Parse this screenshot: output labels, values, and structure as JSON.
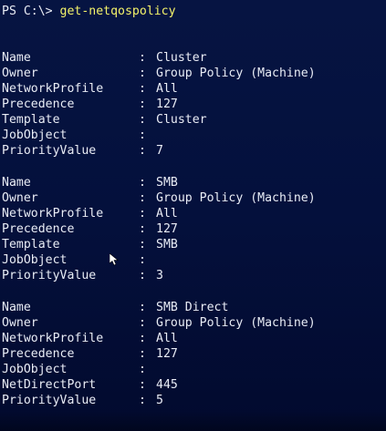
{
  "prompt": {
    "path": "PS C:\\>",
    "command": "get-netqospolicy"
  },
  "policies": [
    {
      "rows": [
        {
          "key": "Name",
          "value": "Cluster"
        },
        {
          "key": "Owner",
          "value": "Group Policy (Machine)"
        },
        {
          "key": "NetworkProfile",
          "value": "All"
        },
        {
          "key": "Precedence",
          "value": "127"
        },
        {
          "key": "Template",
          "value": "Cluster"
        },
        {
          "key": "JobObject",
          "value": ""
        },
        {
          "key": "PriorityValue",
          "value": "7"
        }
      ]
    },
    {
      "rows": [
        {
          "key": "Name",
          "value": "SMB"
        },
        {
          "key": "Owner",
          "value": "Group Policy (Machine)"
        },
        {
          "key": "NetworkProfile",
          "value": "All"
        },
        {
          "key": "Precedence",
          "value": "127"
        },
        {
          "key": "Template",
          "value": "SMB"
        },
        {
          "key": "JobObject",
          "value": ""
        },
        {
          "key": "PriorityValue",
          "value": "3"
        }
      ]
    },
    {
      "rows": [
        {
          "key": "Name",
          "value": "SMB Direct"
        },
        {
          "key": "Owner",
          "value": "Group Policy (Machine)"
        },
        {
          "key": "NetworkProfile",
          "value": "All"
        },
        {
          "key": "Precedence",
          "value": "127"
        },
        {
          "key": "JobObject",
          "value": ""
        },
        {
          "key": "NetDirectPort",
          "value": "445"
        },
        {
          "key": "PriorityValue",
          "value": "5"
        }
      ]
    }
  ],
  "separator": ":",
  "colors": {
    "background": "#04103c",
    "text": "#e9ecf5",
    "command": "#f4f36a"
  },
  "icons": [
    "mouse-pointer-icon"
  ]
}
